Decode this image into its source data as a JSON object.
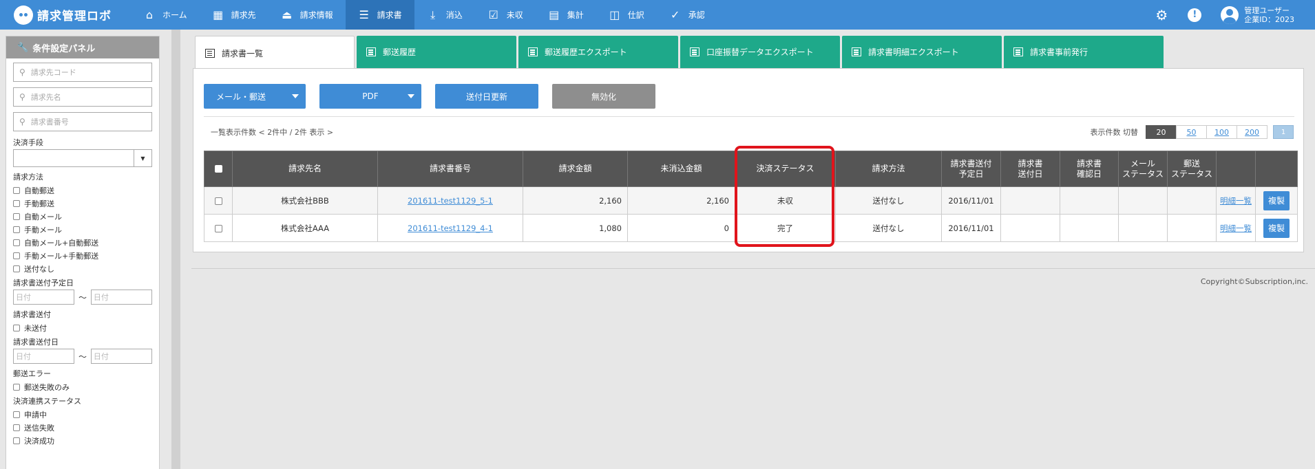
{
  "app": {
    "logo_text": "請求管理ロボ",
    "nav": [
      {
        "label": "ホーム",
        "icon": "home-icon"
      },
      {
        "label": "請求先",
        "icon": "building-icon"
      },
      {
        "label": "請求情報",
        "icon": "inbox-icon"
      },
      {
        "label": "請求書",
        "icon": "list-icon"
      },
      {
        "label": "消込",
        "icon": "download-icon"
      },
      {
        "label": "未収",
        "icon": "check-square-icon"
      },
      {
        "label": "集計",
        "icon": "calculator-icon"
      },
      {
        "label": "仕訳",
        "icon": "columns-icon"
      },
      {
        "label": "承認",
        "icon": "check-circle-icon"
      }
    ],
    "user_name": "管理ユーザー",
    "company_id": "企業ID：2023"
  },
  "sidebar": {
    "title": "条件設定パネル",
    "customer_code_placeholder": "請求先コード",
    "customer_name_placeholder": "請求先名",
    "invoice_no_placeholder": "請求書番号",
    "payment_method_label": "決済手段",
    "billing_method_label": "請求方法",
    "billing_methods": [
      "自動郵送",
      "手動郵送",
      "自動メール",
      "手動メール",
      "自動メール+自動郵送",
      "手動メール+手動郵送",
      "送付なし"
    ],
    "scheduled_date_label": "請求書送付予定日",
    "date_placeholder": "日付",
    "tilde": "〜",
    "sent_label": "請求書送付",
    "unsent": "未送付",
    "sent_date_label": "請求書送付日",
    "postal_error_label": "郵送エラー",
    "postal_fail_only": "郵送失敗のみ",
    "settlement_status_label": "決済連携ステータス",
    "settlement_statuses": [
      "申請中",
      "送信失敗",
      "決済成功"
    ]
  },
  "tabs": [
    "請求書一覧",
    "郵送履歴",
    "郵送履歴エクスポート",
    "口座振替データエクスポート",
    "請求書明細エクスポート",
    "請求書事前発行"
  ],
  "toolbar": {
    "mail_post": "メール・郵送",
    "pdf": "PDF",
    "update_send_date": "送付日更新",
    "invalidate": "無効化"
  },
  "list_info": "一覧表示件数 < 2件中 / 2件 表示 >",
  "pager": {
    "label": "表示件数 切替",
    "sizes": [
      "20",
      "50",
      "100",
      "200"
    ],
    "page": "1"
  },
  "table": {
    "headers": {
      "customer": "請求先名",
      "invoice_no": "請求書番号",
      "amount": "請求金額",
      "unpaid": "未消込金額",
      "payment_status": "決済ステータス",
      "method": "請求方法",
      "scheduled": "請求書送付\n予定日",
      "sent": "請求書\n送付日",
      "confirmed": "請求書\n確認日",
      "mail_status": "メール\nステータス",
      "post_status": "郵送\nステータス"
    },
    "rows": [
      {
        "customer": "株式会社BBB",
        "invoice_no": "201611-test1129_5-1",
        "amount": "2,160",
        "unpaid": "2,160",
        "payment_status": "未収",
        "method": "送付なし",
        "scheduled": "2016/11/01",
        "detail": "明細一覧",
        "copy": "複製"
      },
      {
        "customer": "株式会社AAA",
        "invoice_no": "201611-test1129_4-1",
        "amount": "1,080",
        "unpaid": "0",
        "payment_status": "完了",
        "method": "送付なし",
        "scheduled": "2016/11/01",
        "detail": "明細一覧",
        "copy": "複製"
      }
    ]
  },
  "footer": {
    "copyright": "Copyright©Subscription,inc."
  },
  "colors": {
    "nav_bg": "#3f8cd6",
    "tab_green": "#1ea98a",
    "highlight": "#e0141c"
  }
}
